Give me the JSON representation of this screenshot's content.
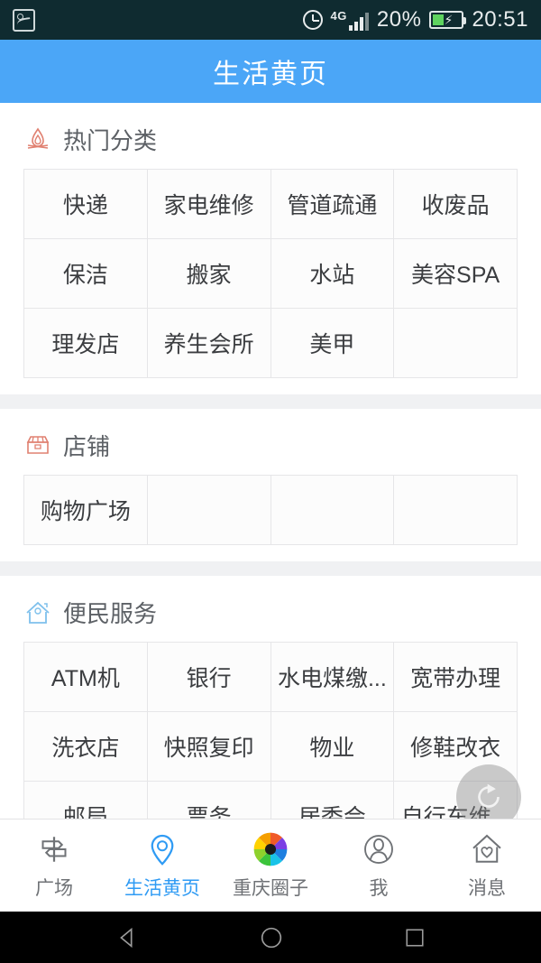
{
  "status_bar": {
    "screenshot_icon": "screenshot-icon",
    "alarm_icon": "alarm-clock-icon",
    "network": "4G",
    "signal_icon": "signal-bars-icon",
    "battery_percent": "20%",
    "battery_icon": "battery-charging-icon",
    "time": "20:51"
  },
  "header": {
    "title": "生活黄页"
  },
  "sections": [
    {
      "id": "hot-categories",
      "icon": "flame-icon",
      "icon_color": "#e08070",
      "label": "热门分类",
      "items": [
        "快递",
        "家电维修",
        "管道疏通",
        "收废品",
        "保洁",
        "搬家",
        "水站",
        "美容SPA",
        "理发店",
        "养生会所",
        "美甲",
        ""
      ]
    },
    {
      "id": "shops",
      "icon": "storefront-icon",
      "icon_color": "#e08070",
      "label": "店铺",
      "items": [
        "购物广场",
        "",
        "",
        ""
      ]
    },
    {
      "id": "convenience-services",
      "icon": "home-icon",
      "icon_color": "#7ec0ec",
      "label": "便民服务",
      "items": [
        "ATM机",
        "银行",
        "水电煤缴...",
        "宽带办理",
        "洗衣店",
        "快照复印",
        "物业",
        "修鞋改衣",
        "邮局",
        "票务",
        "居委会",
        "自行车维..."
      ]
    }
  ],
  "fab": {
    "icon": "refresh-icon"
  },
  "bottom_nav": {
    "active_index": 1,
    "accent_color": "#2f9bf4",
    "items": [
      {
        "label": "广场",
        "icon": "signpost-icon"
      },
      {
        "label": "生活黄页",
        "icon": "location-pin-icon"
      },
      {
        "label": "重庆圈子",
        "icon": "camera-shutter-icon"
      },
      {
        "label": "我",
        "icon": "person-icon"
      },
      {
        "label": "消息",
        "icon": "home-heart-icon"
      }
    ]
  },
  "android_nav": {
    "back": "back-icon",
    "home": "home-circle-icon",
    "recents": "recents-square-icon"
  }
}
